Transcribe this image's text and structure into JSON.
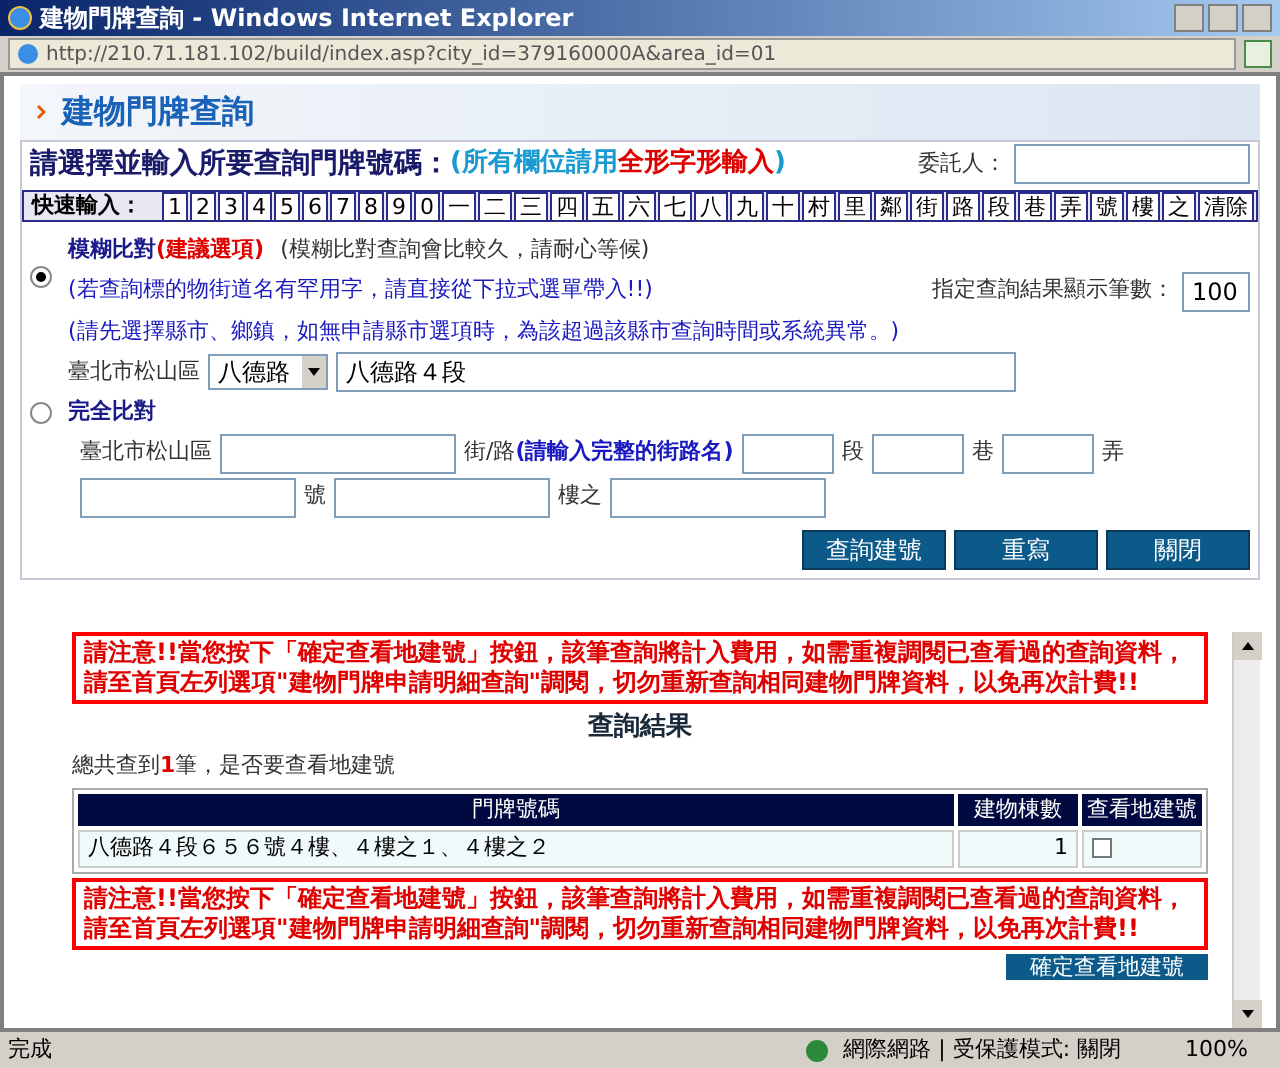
{
  "window": {
    "title": "建物門牌查詢 - Windows Internet Explorer"
  },
  "address_bar": {
    "url": "http://210.71.181.102/build/index.asp?city_id=379160000A&area_id=01"
  },
  "page_header": "建物門牌查詢",
  "form": {
    "prompt": "請選擇並輸入所要查詢門牌號碼：",
    "prompt_hint_open": "(所有欄位請用",
    "prompt_hint_emphasis": "全形字形輸入",
    "prompt_hint_close": ")",
    "client_label": "委託人：",
    "quick_input": {
      "label": "快速輸入：",
      "keys": [
        "1",
        "2",
        "3",
        "4",
        "5",
        "6",
        "7",
        "8",
        "9",
        "0",
        "一",
        "二",
        "三",
        "四",
        "五",
        "六",
        "七",
        "八",
        "九",
        "十",
        "村",
        "里",
        "鄰",
        "街",
        "路",
        "段",
        "巷",
        "弄",
        "號",
        "樓",
        "之",
        "清除"
      ]
    },
    "fuzzy": {
      "selected": true,
      "title": "模糊比對",
      "tag": "(建議選項)",
      "note": "(模糊比對查詢會比較久，請耐心等候)",
      "hints": [
        "(若查詢標的物街道名有罕用字，請直接從下拉式選單帶入!!)",
        "(請先選擇縣市、鄉鎮，如無申請縣市選項時，為該超過該縣市查詢時間或系統異常。)"
      ],
      "district": "臺北市松山區",
      "dropdown": "八德路",
      "road": "八德路４段"
    },
    "result_limit": {
      "label": "指定查詢結果顯示筆數：",
      "value": "100"
    },
    "exact": {
      "selected": false,
      "title": "完全比對",
      "district": "臺北市松山區",
      "street_label": "街/路",
      "street_hint": "(請輸入完整的街路名)",
      "section_label": "段",
      "lane_label": "巷",
      "alley_label": "弄",
      "number_label": "號",
      "floor_label": "樓之"
    },
    "buttons": [
      "查詢建號",
      "重寫",
      "關閉"
    ]
  },
  "results": {
    "notice_top": "請注意!!當您按下「確定查看地建號」按鈕，該筆查詢將計入費用，如需重複調閱已查看過的查詢資料，請至首頁左列選項\"建物門牌申請明細查詢\"調閱，切勿重新查詢相同建物門牌資料，以免再次計費!!",
    "title": "查詢結果",
    "summary": "總共查到**1**筆，是否要查看地建號",
    "columns": [
      "門牌號碼",
      "建物棟數",
      "查看地建號"
    ],
    "rows": [
      {
        "address": "八德路４段６５６號４樓、４樓之１、４樓之２",
        "count": "1",
        "checked": false
      }
    ],
    "notice_bottom": "請注意!!當您按下「確定查看地建號」按鈕，該筆查詢將計入費用，如需重複調閱已查看過的查詢資料，請至首頁左列選項\"建物門牌申請明細查詢\"調閱，切勿重新查詢相同建物門牌資料，以免再次計費!!",
    "confirm_button": "確定查看地建號"
  },
  "status_bar": {
    "text": "完成",
    "zone": "網際網路 | 受保護模式: 關閉",
    "zoom": "100%"
  }
}
